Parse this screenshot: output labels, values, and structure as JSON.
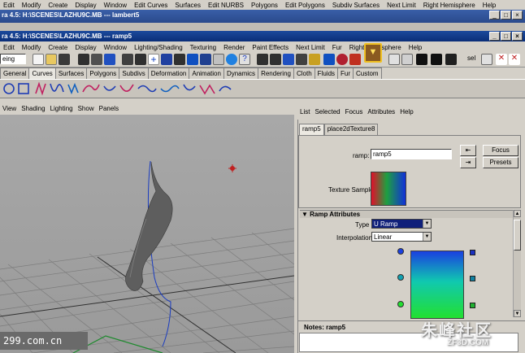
{
  "back_menu": [
    "Edit",
    "Modify",
    "Create",
    "Display",
    "Window",
    "Edit Curves",
    "Surfaces",
    "Edit NURBS",
    "Polygons",
    "Edit Polygons",
    "Subdiv Surfaces",
    "Next Limit",
    "Right Hemisphere",
    "Help"
  ],
  "back_title": "ra 4.5: H:\\SCENES\\LAZHU9C.MB  ---  lambert5",
  "title": "ra 4.5: H:\\SCENES\\LAZHU9C.MB  ---  ramp5",
  "main_menu": [
    "Edit",
    "Modify",
    "Create",
    "Display",
    "Window",
    "Lighting/Shading",
    "Texturing",
    "Render",
    "Paint Effects",
    "Next Limit",
    "Fur",
    "Right Hemisphere",
    "Help"
  ],
  "mode_select": "eing",
  "toolbar_sel": "sel",
  "shelf_tabs": [
    "General",
    "Curves",
    "Surfaces",
    "Polygons",
    "Subdivs",
    "Deformation",
    "Animation",
    "Dynamics",
    "Rendering",
    "Cloth",
    "Fluids",
    "Fur",
    "Custom"
  ],
  "active_shelf": "Curves",
  "viewport_menu": [
    "View",
    "Shading",
    "Lighting",
    "Show",
    "Panels"
  ],
  "attr_menu": [
    "List",
    "Selected",
    "Focus",
    "Attributes",
    "Help"
  ],
  "attr_tabs": [
    "ramp5",
    "place2dTexture8"
  ],
  "ramp_label": "ramp:",
  "ramp_name": "ramp5",
  "focus_btn": "Focus",
  "presets_btn": "Presets",
  "texture_sample_label": "Texture Sample",
  "section_title": "Ramp Attributes",
  "type_label": "Type",
  "type_value": "U Ramp",
  "interp_label": "Interpolation",
  "interp_value": "Linear",
  "notes_label": "Notes: ramp5",
  "watermark_left": "299.com.cn",
  "watermark_right_cn": "朱峰社区",
  "watermark_right_en": "ZF3D.COM",
  "colors": {
    "titlebar": "#0a2e78",
    "ramp_top": "#1a40e0",
    "ramp_mid": "#10c8b0",
    "ramp_bottom": "#22e030"
  }
}
